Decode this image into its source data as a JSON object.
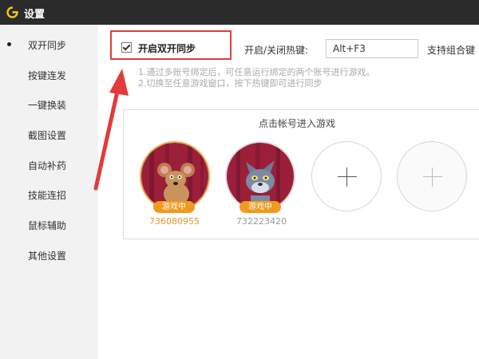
{
  "window": {
    "title": "设置"
  },
  "sidebar": {
    "items": [
      {
        "label": "双开同步",
        "active": true
      },
      {
        "label": "按键连发"
      },
      {
        "label": "一键换装"
      },
      {
        "label": "截图设置"
      },
      {
        "label": "自动补药"
      },
      {
        "label": "技能连招"
      },
      {
        "label": "鼠标辅助"
      },
      {
        "label": "其他设置"
      }
    ]
  },
  "sync": {
    "checkbox_label": "开启双开同步",
    "checked": true,
    "hotkey_label": "开启/关闭热键:",
    "hotkey_value": "Alt+F3",
    "combo_note": "支持组合键",
    "hints": [
      "1.通过多账号绑定后，可任意运行绑定的两个账号进行游戏。",
      "2.切换至任意游戏窗口，按下热键即可进行同步"
    ]
  },
  "accounts": {
    "title": "点击帐号进入游戏",
    "list": [
      {
        "status": "游戏中",
        "id": "736080955",
        "avatar_icon": "jerry-mouse-icon"
      },
      {
        "status": "游戏中",
        "id": "732223420",
        "avatar_icon": "tom-cat-icon"
      }
    ],
    "add_slots": 2
  },
  "colors": {
    "titlebar": "#2b2b2b",
    "accent": "#f09a1e",
    "annotation": "#e33a3a"
  }
}
